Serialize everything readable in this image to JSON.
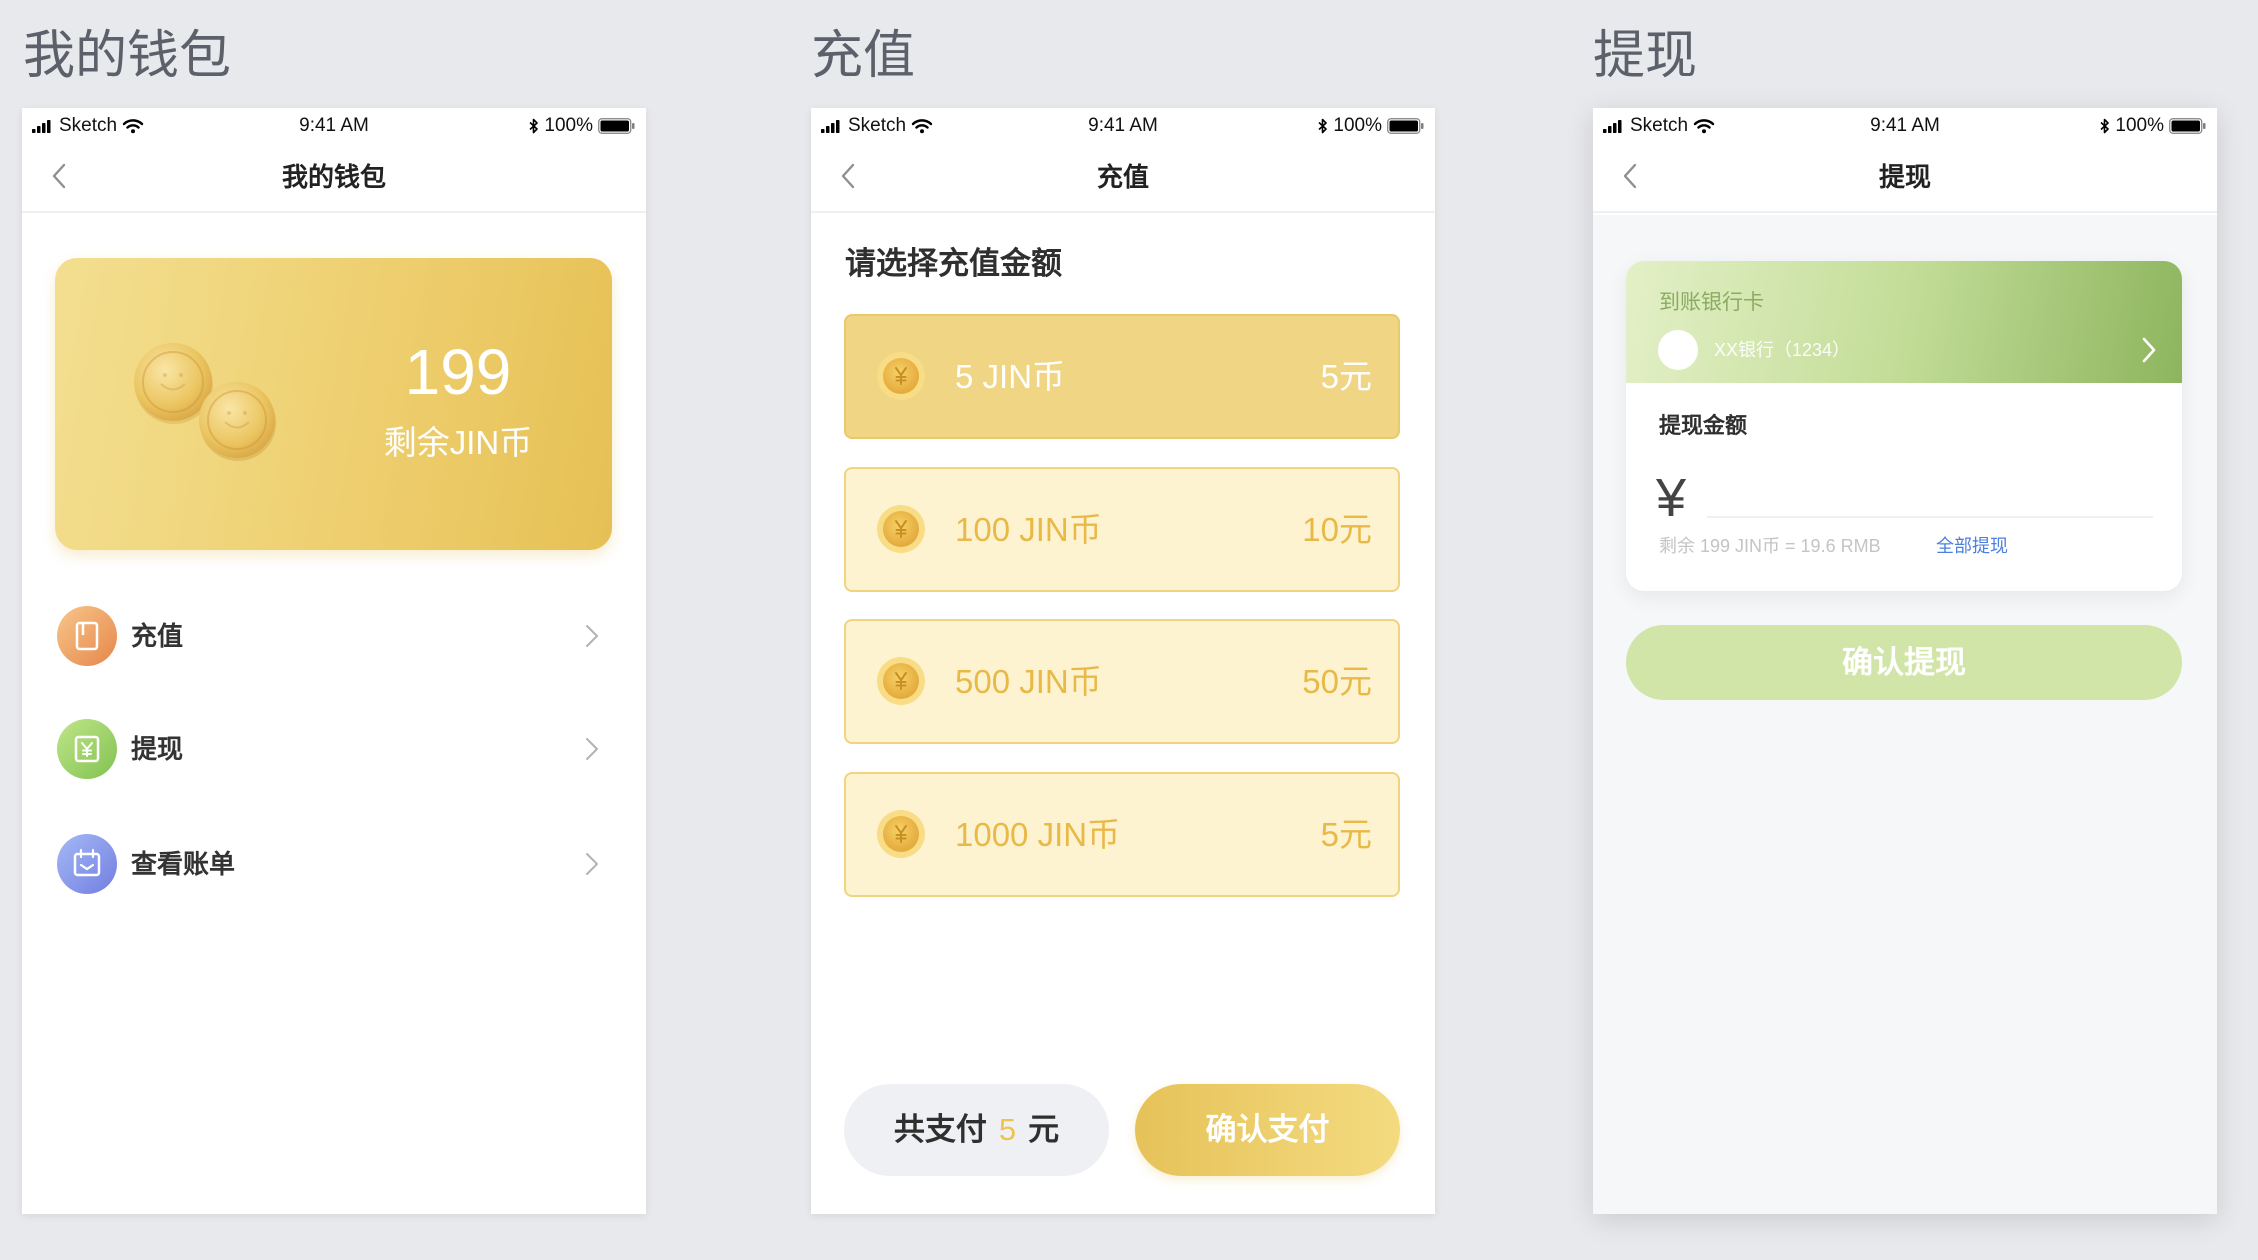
{
  "status_bar": {
    "carrier": "Sketch",
    "time": "9:41 AM",
    "battery": "100%",
    "icons": [
      "signal-icon",
      "wifi-icon",
      "bluetooth-icon",
      "battery-icon"
    ]
  },
  "wallet": {
    "section_title": "我的钱包",
    "nav_title": "我的钱包",
    "balance": "199",
    "balance_label": "剩余JIN币",
    "menu": [
      {
        "label": "充值",
        "icon": "recharge-icon"
      },
      {
        "label": "提现",
        "icon": "withdraw-icon"
      },
      {
        "label": "查看账单",
        "icon": "bill-icon"
      }
    ]
  },
  "recharge": {
    "section_title": "充值",
    "nav_title": "充值",
    "prompt": "请选择充值金额",
    "options": [
      {
        "label": "5 JIN币",
        "price": "5元",
        "selected": true
      },
      {
        "label": "100 JIN币",
        "price": "10元",
        "selected": false
      },
      {
        "label": "500 JIN币",
        "price": "50元",
        "selected": false
      },
      {
        "label": "1000 JIN币",
        "price": "5元",
        "selected": false
      }
    ],
    "total": {
      "prefix": "共支付",
      "amount": "5",
      "suffix": "元"
    },
    "confirm_label": "确认支付"
  },
  "withdraw": {
    "section_title": "提现",
    "nav_title": "提现",
    "bank_card_label": "到账银行卡",
    "bank_name": "XX银行（1234）",
    "amount_label": "提现金额",
    "currency_symbol": "¥",
    "hint": "剩余 199 JIN币 = 19.6 RMB",
    "withdraw_all_label": "全部提现",
    "confirm_label": "确认提现"
  },
  "colors": {
    "page_background": "#e8e9ec",
    "gold_accent": "#f0c34e",
    "green_accent": "#8db55e",
    "link_blue": "#4b7fe0"
  }
}
